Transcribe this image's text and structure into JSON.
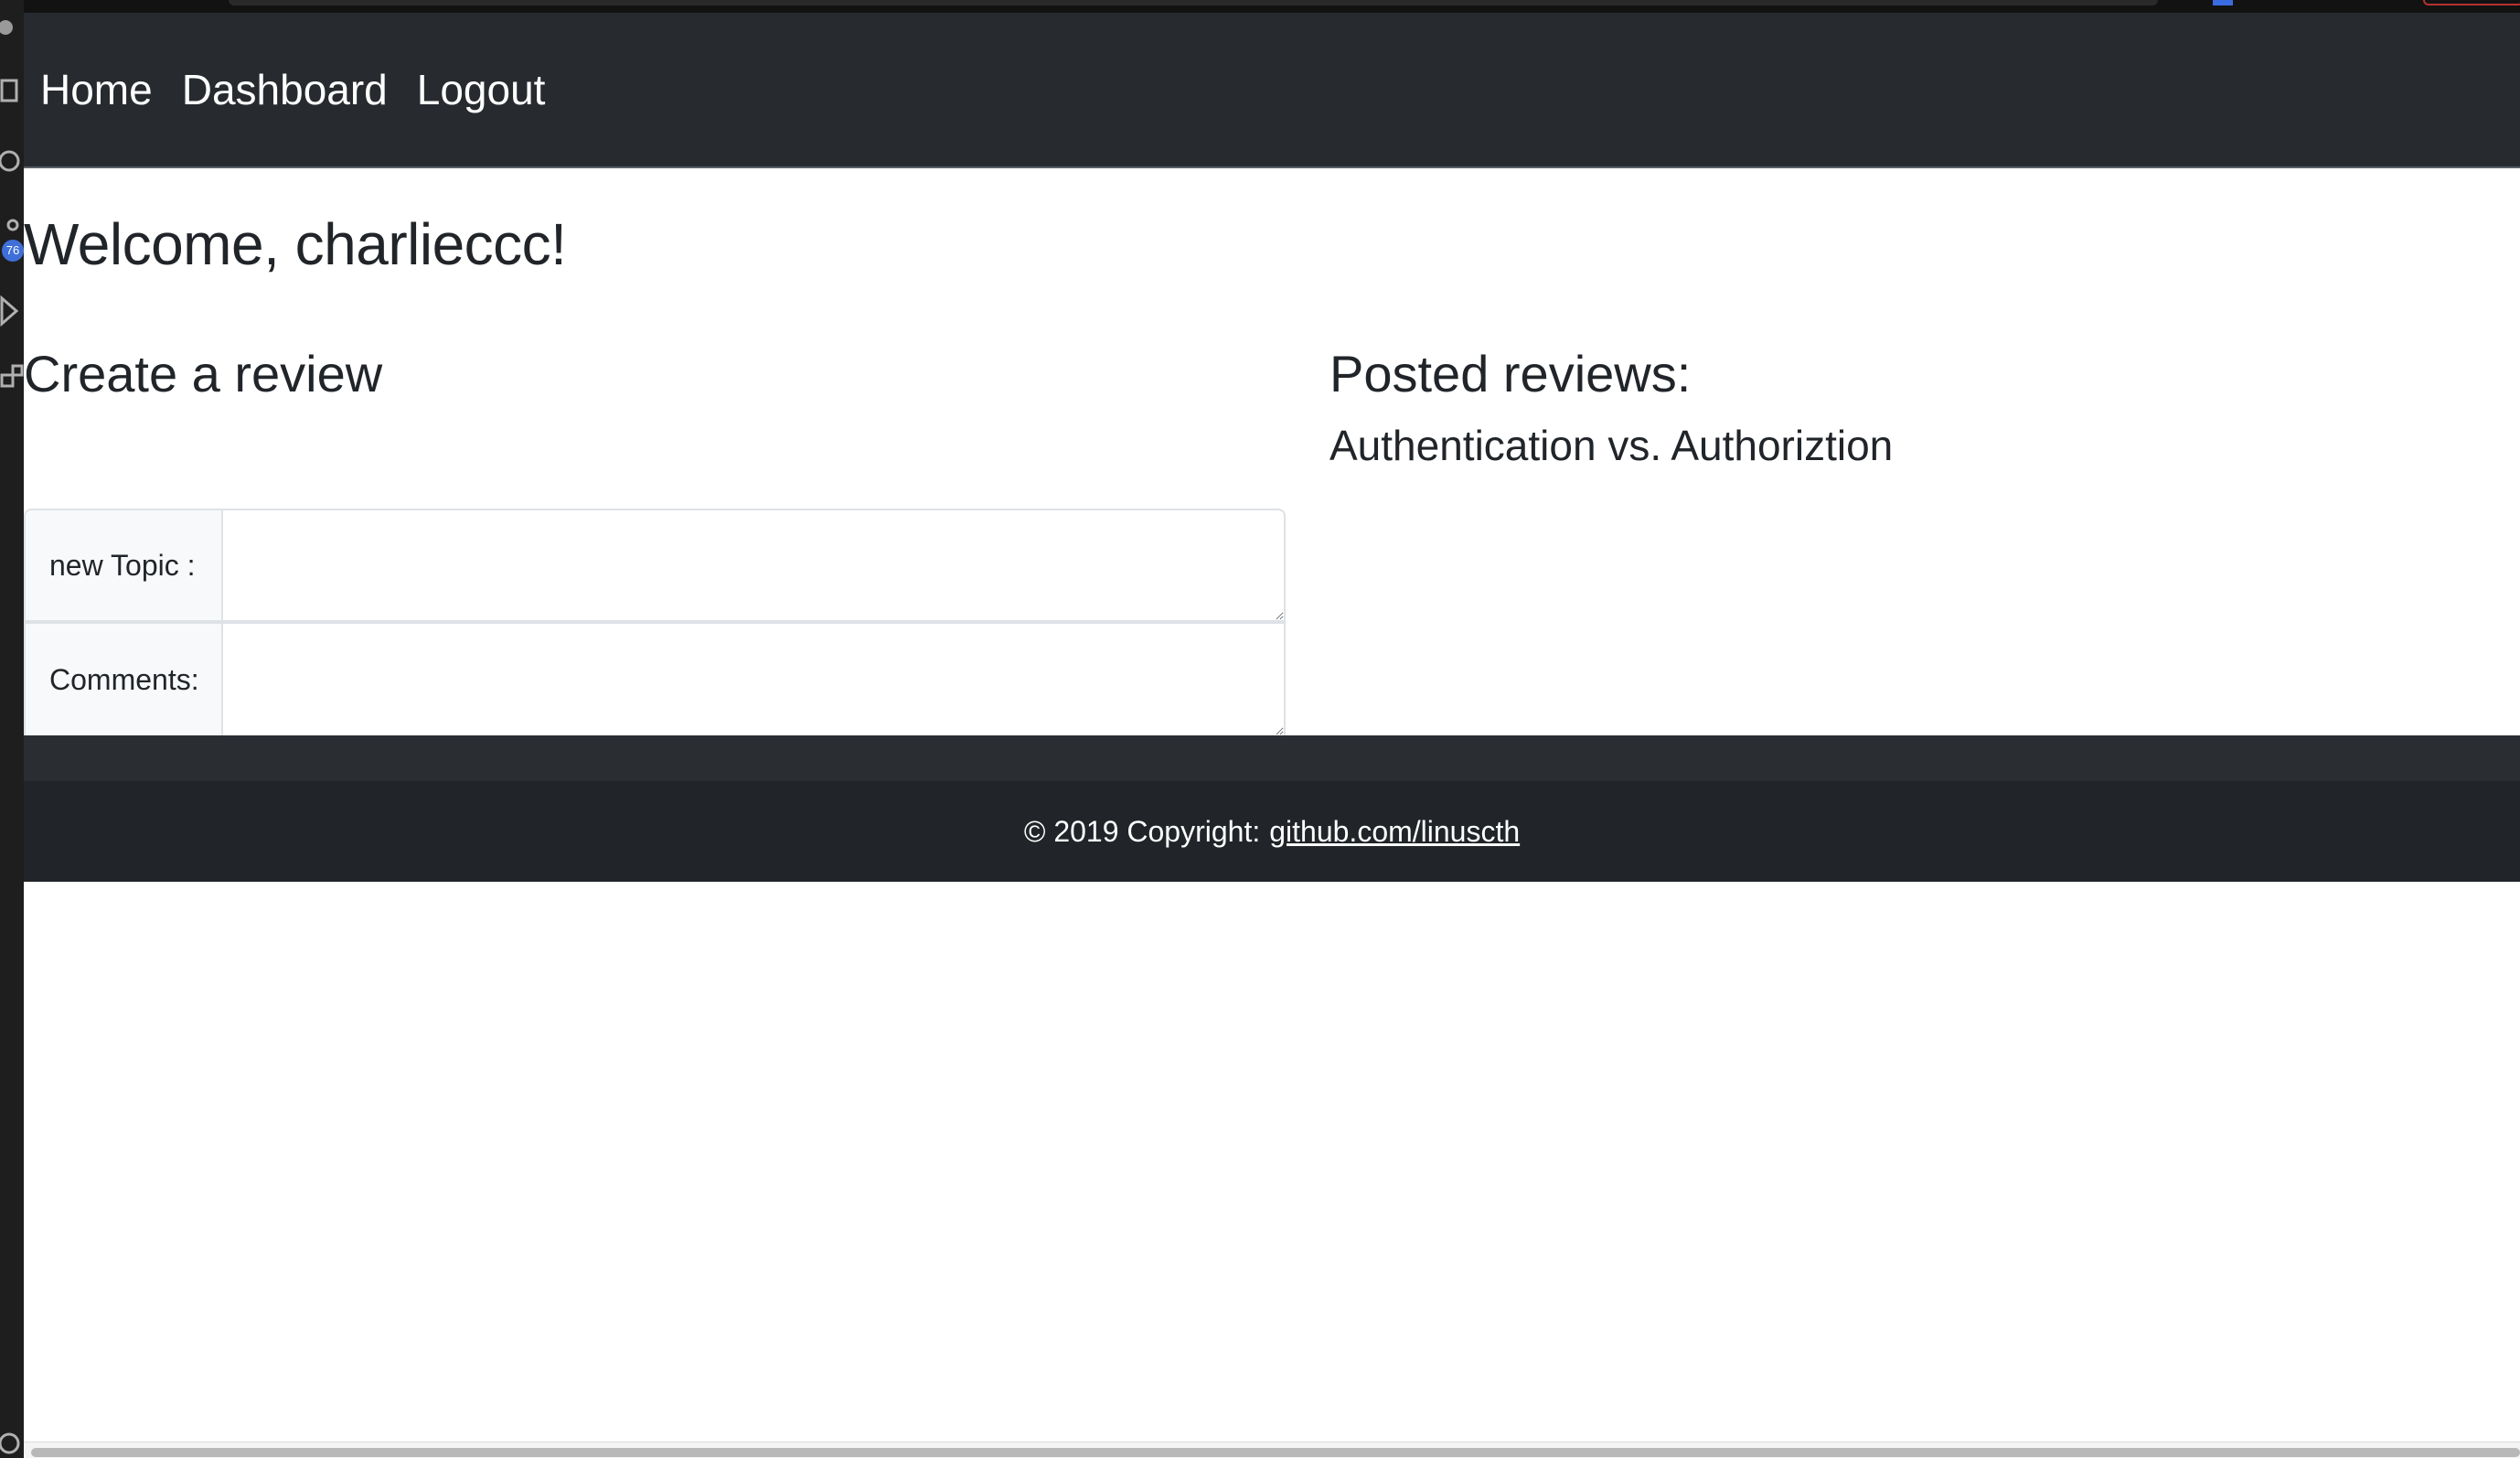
{
  "nav": {
    "links": [
      "Home",
      "Dashboard",
      "Logout"
    ]
  },
  "main": {
    "welcome": "Welcome, charlieccc!",
    "create_heading": "Create a review",
    "posted_heading": "Posted reviews:",
    "posted_reviews": [
      "Authentication vs. Authoriztion"
    ],
    "form": {
      "topic_label": "new Topic :",
      "topic_value": "",
      "comments_label": "Comments:",
      "comments_value": ""
    }
  },
  "footer": {
    "text": "© 2019 Copyright:",
    "link": "github.com/linuscth"
  },
  "sidebar": {
    "badge": "76"
  }
}
